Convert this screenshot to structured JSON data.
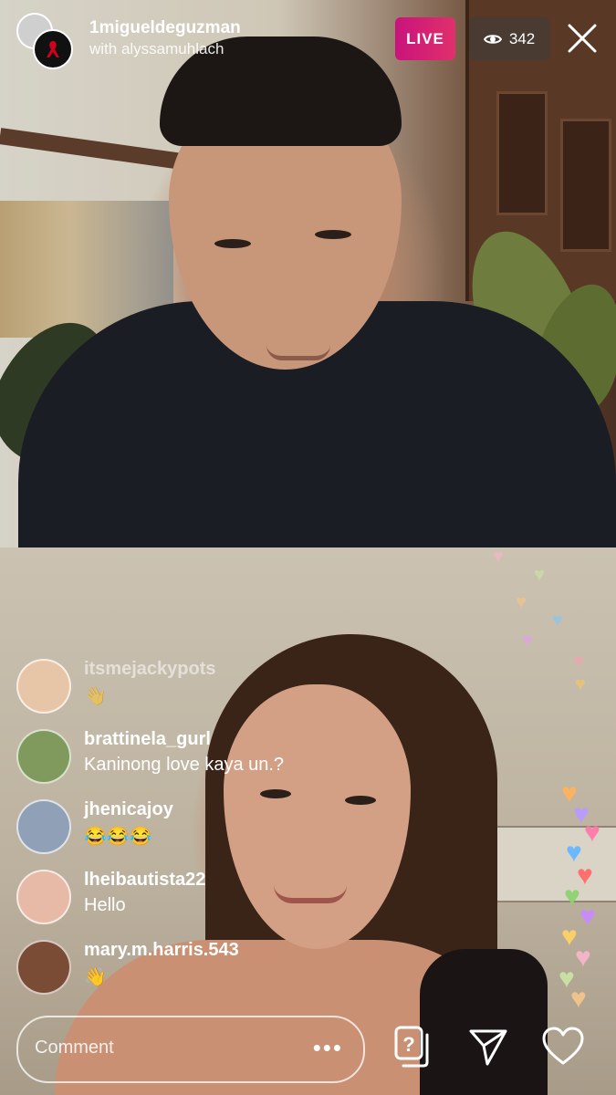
{
  "header": {
    "host_username": "1migueldeguzman",
    "with_text": "with alyssamuhlach",
    "live_label": "LIVE",
    "viewer_count": "342"
  },
  "comments": [
    {
      "username": "itsmejackypots",
      "text": "👋",
      "avatar_color": "#e7c6a8",
      "faded": true
    },
    {
      "username": "brattinela_gurl",
      "text": "Kaninong love kaya un.?",
      "avatar_color": "#7f9a5c",
      "faded": false
    },
    {
      "username": "jhenicajoy",
      "text": "😂😂😂",
      "avatar_color": "#8fa0b7",
      "faded": false
    },
    {
      "username": "lheibautista22",
      "text": "Hello",
      "avatar_color": "#e7b9a7",
      "faded": false
    },
    {
      "username": "mary.m.harris.543",
      "text": "👋",
      "avatar_color": "#7a4c35",
      "faded": false
    }
  ],
  "composer": {
    "placeholder": "Comment",
    "more_glyph": "•••"
  },
  "hearts": [
    "#f5b6c8",
    "#c9e3a4",
    "#f3c68a",
    "#88c7f0",
    "#e6a0f0",
    "#f6a2b2",
    "#f7c66b",
    "#ffb35c",
    "#b89aff",
    "#ff7aa8",
    "#66b7ff",
    "#ff6b6b",
    "#8dd36f",
    "#c98bff",
    "#ffd166"
  ]
}
